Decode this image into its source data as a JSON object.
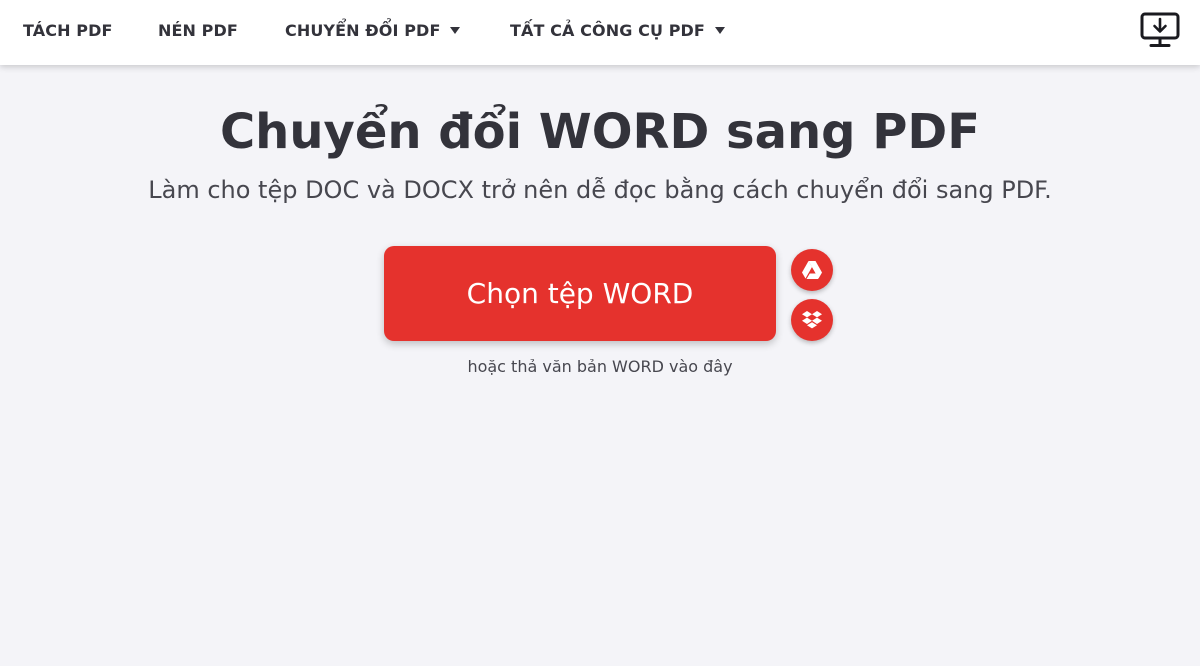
{
  "nav": {
    "split": "TÁCH PDF",
    "compress": "NÉN PDF",
    "convert": "CHUYỂN ĐỔI PDF",
    "all_tools": "TẤT CẢ CÔNG CỤ PDF"
  },
  "hero": {
    "title": "Chuyển đổi WORD sang PDF",
    "subtitle": "Làm cho tệp DOC và DOCX trở nên dễ đọc bằng cách chuyển đổi sang PDF."
  },
  "upload": {
    "button_label": "Chọn tệp WORD",
    "drop_hint": "hoặc thả văn bản WORD vào đây"
  },
  "icons": {
    "desktop": "desktop-download-icon",
    "drive": "google-drive-icon",
    "dropbox": "dropbox-icon"
  },
  "colors": {
    "accent": "#e5322d",
    "text": "#33333b",
    "background": "#f4f4f8"
  }
}
